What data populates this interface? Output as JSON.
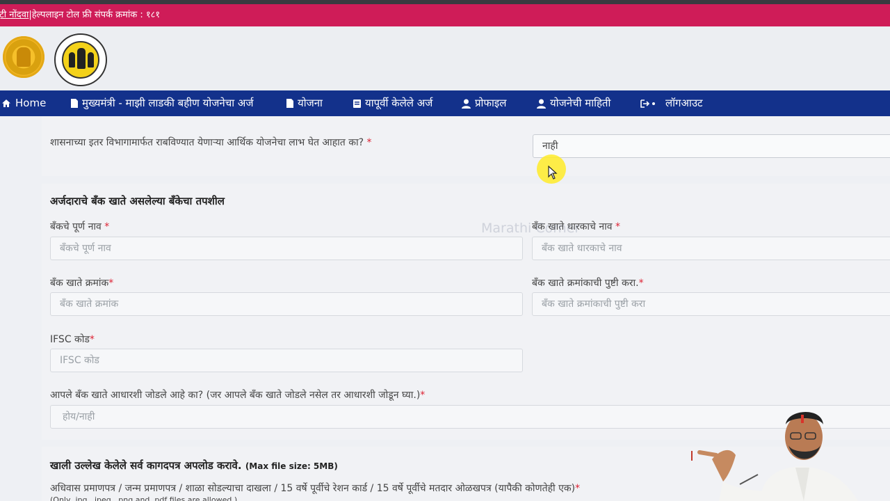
{
  "top_strip": {
    "link_text": "त्रुटी नोंदवा",
    "separator": " | ",
    "helpline": "हेल्पलाइन टोल फ्री संपर्क क्रमांक : १८१"
  },
  "nav": {
    "items": [
      {
        "icon": "home-icon",
        "label": "Home"
      },
      {
        "icon": "document-icon",
        "label": "मुख्यमंत्री - माझी लाडकी बहीण योजनेचा अर्ज"
      },
      {
        "icon": "document-icon",
        "label": "योजना"
      },
      {
        "icon": "list-icon",
        "label": "यापूर्वी केलेले अर्ज"
      },
      {
        "icon": "user-icon",
        "label": "प्रोफाइल"
      },
      {
        "icon": "user-icon",
        "label": "योजनेची माहिती"
      },
      {
        "icon": "logout-icon",
        "label": "लॉगआउट"
      }
    ]
  },
  "form": {
    "other_scheme": {
      "label": "शासनाच्या इतर विभागामार्फत राबविण्यात येणाऱ्या आर्थिक योजनेचा लाभ घेत आहात का?",
      "required": "*",
      "value": "नाही"
    },
    "bank_section": {
      "title": "अर्जदाराचे बँक खाते असलेल्या बँकेचा तपशील",
      "bank_name": {
        "label": "बँकचे पूर्ण नाव",
        "required": "*",
        "placeholder": "बँकचे पूर्ण नाव"
      },
      "holder_name": {
        "label": "बँक खाते धारकाचे नाव",
        "required": "*",
        "placeholder": "बँक खाते धारकाचे नाव"
      },
      "account_no": {
        "label": "बँक खाते क्रमांक",
        "required": "*",
        "placeholder": "बँक खाते क्रमांक"
      },
      "account_confirm": {
        "label": "बँक खाते क्रमांकाची पुष्टी करा.",
        "required": "*",
        "placeholder": "बँक खाते क्रमांकाची पुष्टी करा"
      },
      "ifsc": {
        "label": "IFSC कोड",
        "required": "*",
        "placeholder": "IFSC कोड"
      },
      "aadhaar_link": {
        "label": "आपले बँक खाते आधारशी जोडले आहे का? (जर आपले बँक खाते जोडले नसेल तर आधारशी जोडून घ्या.)",
        "required": "*",
        "placeholder": "होय/नाही"
      }
    },
    "documents": {
      "title": "खाली उल्लेख केलेले सर्व कागदपत्र अपलोड करावे.",
      "title_note": "(Max file size: 5MB)",
      "domicile_label": "अधिवास प्रमाणपत्र / जन्म प्रमाणपत्र / शाळा सोडल्याचा दाखला / 15 वर्षे पूर्वीचे रेशन कार्ड / 15 वर्षे पूर्वीचे मतदार ओळखपत्र (यापैकी कोणतेही एक)",
      "required": "*",
      "allowed_note": "(Only .jpg, .jpeg, .png and .pdf files are allowed.)"
    }
  },
  "watermark": "Marathi Corner"
}
